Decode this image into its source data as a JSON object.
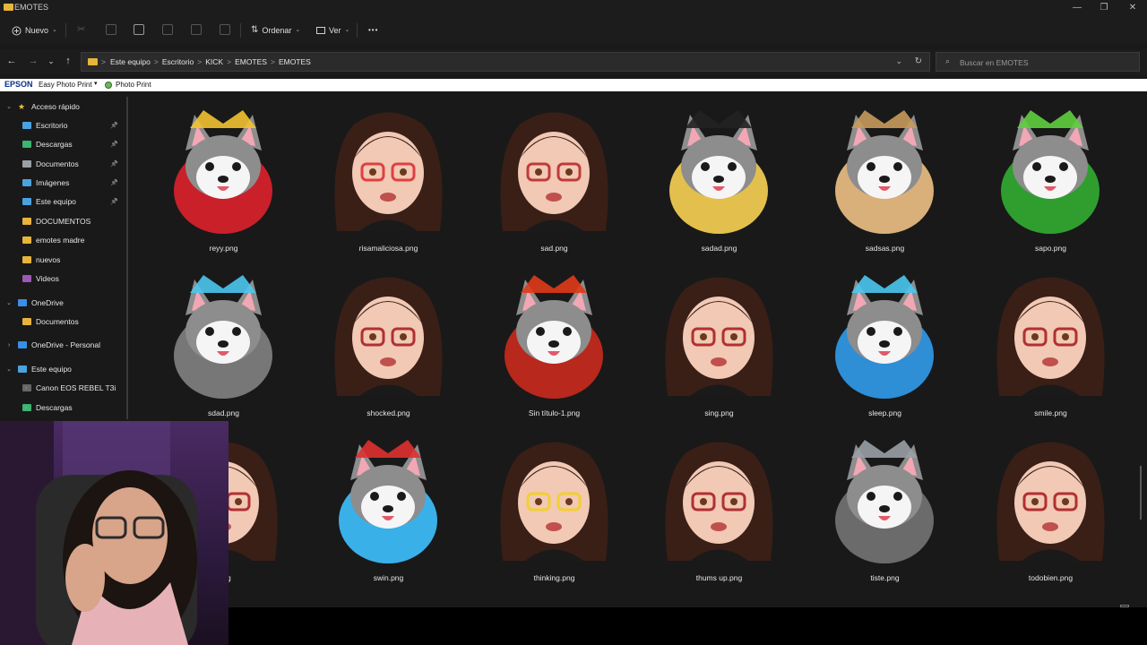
{
  "window": {
    "title": "EMOTES",
    "controls": [
      "—",
      "❐",
      "✕"
    ]
  },
  "toolbar": {
    "new_label": "Nuevo",
    "sort_label": "Ordenar",
    "view_label": "Ver",
    "more_label": "•••"
  },
  "address": {
    "breadcrumbs": [
      "Este equipo",
      "Escritorio",
      "KICK",
      "EMOTES",
      "EMOTES"
    ],
    "separator": ">",
    "search_placeholder": "Buscar en EMOTES"
  },
  "epson_bar": {
    "brand": "EPSON",
    "easy_photo_print": "Easy Photo Print",
    "photo_print": "Photo Print"
  },
  "sidebar": {
    "items": [
      {
        "label": "Acceso rápido",
        "level": 0,
        "icon": "star-icon",
        "color": "#f0c040",
        "pinned": false,
        "chevron": "down"
      },
      {
        "label": "Escritorio",
        "level": 1,
        "icon": "desktop-icon",
        "color": "#4aa3df",
        "pinned": true
      },
      {
        "label": "Descargas",
        "level": 1,
        "icon": "download-icon",
        "color": "#3cb371",
        "pinned": true
      },
      {
        "label": "Documentos",
        "level": 1,
        "icon": "document-icon",
        "color": "#9aa0a6",
        "pinned": true
      },
      {
        "label": "Imágenes",
        "level": 1,
        "icon": "image-icon",
        "color": "#4aa3df",
        "pinned": true
      },
      {
        "label": "Este equipo",
        "level": 1,
        "icon": "computer-icon",
        "color": "#4aa3df",
        "pinned": true
      },
      {
        "label": "DOCUMENTOS",
        "level": 1,
        "icon": "folder-icon",
        "color": "#e7b43c",
        "pinned": false
      },
      {
        "label": "emotes madre",
        "level": 1,
        "icon": "folder-icon",
        "color": "#e7b43c",
        "pinned": false
      },
      {
        "label": "nuevos",
        "level": 1,
        "icon": "folder-icon",
        "color": "#e7b43c",
        "pinned": false
      },
      {
        "label": "Videos",
        "level": 1,
        "icon": "video-icon",
        "color": "#9b59b6",
        "pinned": false
      },
      {
        "label": "OneDrive",
        "level": 0,
        "icon": "cloud-icon",
        "color": "#3a8ee6",
        "pinned": false,
        "chevron": "down"
      },
      {
        "label": "Documentos",
        "level": 1,
        "icon": "folder-icon",
        "color": "#e7b43c",
        "pinned": false
      },
      {
        "label": "OneDrive - Personal",
        "level": 0,
        "icon": "cloud-icon",
        "color": "#3a8ee6",
        "pinned": false,
        "chevron": "right"
      },
      {
        "label": "Este equipo",
        "level": 0,
        "icon": "computer-icon",
        "color": "#4aa3df",
        "pinned": false,
        "chevron": "down"
      },
      {
        "label": "Canon EOS REBEL T3i",
        "level": 1,
        "icon": "camera-icon",
        "color": "#666666",
        "pinned": false,
        "chevron": "right"
      },
      {
        "label": "Descargas",
        "level": 1,
        "icon": "download-icon",
        "color": "#3cb371",
        "pinned": false,
        "chevron": "right"
      }
    ]
  },
  "files": [
    {
      "name": "reyy.png",
      "kind": "husky",
      "accent": "#f2c230",
      "fill": "#c9202a"
    },
    {
      "name": "risamaliciosa.png",
      "kind": "girl",
      "accent": "#e04040",
      "fill": "#3a1f17"
    },
    {
      "name": "sad.png",
      "kind": "girl",
      "accent": "#c23a3a",
      "fill": "#3a1f17"
    },
    {
      "name": "sadad.png",
      "kind": "husky",
      "accent": "#222222",
      "fill": "#e3c04d"
    },
    {
      "name": "sadsas.png",
      "kind": "husky",
      "accent": "#c89a5b",
      "fill": "#d9b07a"
    },
    {
      "name": "sapo.png",
      "kind": "husky",
      "accent": "#5fcf3f",
      "fill": "#2f9e2f"
    },
    {
      "name": "sdad.png",
      "kind": "husky",
      "accent": "#4ac8f0",
      "fill": "#777777"
    },
    {
      "name": "shocked.png",
      "kind": "girl",
      "accent": "#b23030",
      "fill": "#3a1f17"
    },
    {
      "name": "Sin título-1.png",
      "kind": "husky",
      "accent": "#e03a1a",
      "fill": "#b8281c"
    },
    {
      "name": "sing.png",
      "kind": "girl",
      "accent": "#b23030",
      "fill": "#3a1f17"
    },
    {
      "name": "sleep.png",
      "kind": "husky",
      "accent": "#4ac8f0",
      "fill": "#2e8ed6"
    },
    {
      "name": "smile.png",
      "kind": "girl",
      "accent": "#b23030",
      "fill": "#3a1f17"
    },
    {
      "name": ".png",
      "kind": "girl",
      "accent": "#b23030",
      "fill": "#3a1f17"
    },
    {
      "name": "swin.png",
      "kind": "husky",
      "accent": "#e03030",
      "fill": "#3ab0e8"
    },
    {
      "name": "thinking.png",
      "kind": "girl",
      "accent": "#f2d030",
      "fill": "#3a1f17"
    },
    {
      "name": "thums up.png",
      "kind": "girl",
      "accent": "#b23030",
      "fill": "#3a1f17"
    },
    {
      "name": "tiste.png",
      "kind": "husky",
      "accent": "#9aa0a6",
      "fill": "#6b6b6b"
    },
    {
      "name": "todobien.png",
      "kind": "girl",
      "accent": "#b23030",
      "fill": "#3a1f17"
    }
  ]
}
